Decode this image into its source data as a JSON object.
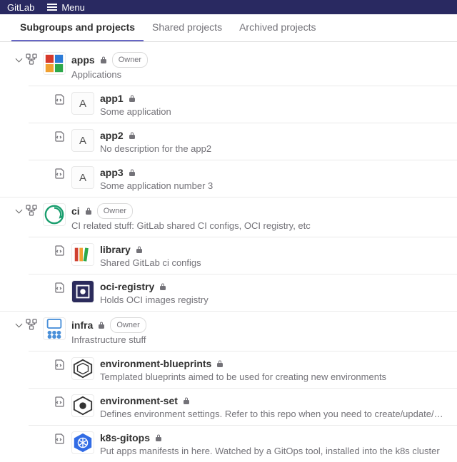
{
  "topbar": {
    "logo": "GitLab",
    "menu": "Menu"
  },
  "tabs": [
    {
      "label": "Subgroups and projects",
      "active": true
    },
    {
      "label": "Shared projects",
      "active": false
    },
    {
      "label": "Archived projects",
      "active": false
    }
  ],
  "owner_badge": "Owner",
  "groups": [
    {
      "name": "apps",
      "desc": "Applications",
      "avatar": "apps",
      "owner": true,
      "children": [
        {
          "name": "app1",
          "desc": "Some application",
          "avatar_letter": "A"
        },
        {
          "name": "app2",
          "desc": "No description for the app2",
          "avatar_letter": "A"
        },
        {
          "name": "app3",
          "desc": "Some application number 3",
          "avatar_letter": "A"
        }
      ]
    },
    {
      "name": "ci",
      "desc": "CI related stuff: GitLab shared CI configs, OCI registry, etc",
      "avatar": "ci",
      "owner": true,
      "children": [
        {
          "name": "library",
          "desc": "Shared GitLab ci configs",
          "avatar": "library"
        },
        {
          "name": "oci-registry",
          "desc": "Holds OCI images registry",
          "avatar": "oci"
        }
      ]
    },
    {
      "name": "infra",
      "desc": "Infrastructure stuff",
      "avatar": "infra",
      "owner": true,
      "children": [
        {
          "name": "environment-blueprints",
          "desc": "Templated blueprints aimed to be used for creating new environments",
          "avatar": "env-bp"
        },
        {
          "name": "environment-set",
          "desc": "Defines environment settings. Refer to this repo when you need to create/update/delete an environment",
          "avatar": "env-set"
        },
        {
          "name": "k8s-gitops",
          "desc": "Put apps manifests in here. Watched by a GitOps tool, installed into the k8s cluster",
          "avatar": "k8s"
        }
      ]
    }
  ]
}
